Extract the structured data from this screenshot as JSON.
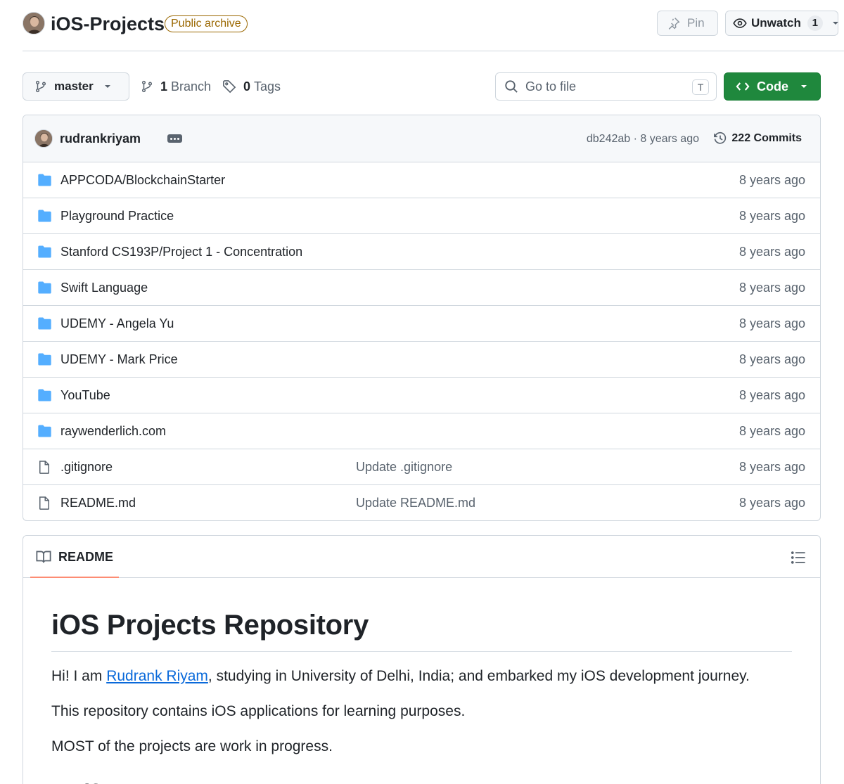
{
  "repo": {
    "name": "iOS-Projects",
    "badge": "Public archive",
    "pin_label": "Pin",
    "watch_label": "Unwatch",
    "watch_count": "1"
  },
  "toolbar": {
    "branch": "master",
    "branch_count": "1",
    "branch_label": "Branch",
    "tag_count": "0",
    "tag_label": "Tags",
    "search_placeholder": "Go to file",
    "search_shortcut": "T",
    "code_label": "Code"
  },
  "commit": {
    "author": "rudrankriyam",
    "sha_age": "db242ab · 8 years ago",
    "commits_label": "222 Commits"
  },
  "files": [
    {
      "type": "dir",
      "name": "APPCODA/BlockchainStarter",
      "message": "",
      "age": "8 years ago"
    },
    {
      "type": "dir",
      "name": "Playground Practice",
      "message": "",
      "age": "8 years ago"
    },
    {
      "type": "dir",
      "name": "Stanford CS193P/Project 1 - Concentration",
      "message": "",
      "age": "8 years ago"
    },
    {
      "type": "dir",
      "name": "Swift Language",
      "message": "",
      "age": "8 years ago"
    },
    {
      "type": "dir",
      "name": "UDEMY - Angela Yu",
      "message": "",
      "age": "8 years ago"
    },
    {
      "type": "dir",
      "name": "UDEMY - Mark Price",
      "message": "",
      "age": "8 years ago"
    },
    {
      "type": "dir",
      "name": "YouTube",
      "message": "",
      "age": "8 years ago"
    },
    {
      "type": "dir",
      "name": "raywenderlich.com",
      "message": "",
      "age": "8 years ago"
    },
    {
      "type": "file",
      "name": ".gitignore",
      "message": "Update .gitignore",
      "age": "8 years ago"
    },
    {
      "type": "file",
      "name": "README.md",
      "message": "Update README.md",
      "age": "8 years ago"
    }
  ],
  "readme": {
    "tab_label": "README",
    "title": "iOS Projects Repository",
    "intro_before": "Hi! I am ",
    "intro_link": "Rudrank Riyam",
    "intro_after": ", studying in University of Delhi, India; and embarked my iOS development journey.",
    "p2": "This repository contains iOS applications for learning purposes.",
    "p3": "MOST of the projects are work in progress.",
    "h2": "Swift Language"
  },
  "colors": {
    "folder": "#54aeff",
    "code_button": "#1f883d",
    "badge": "#9a6700",
    "link": "#0969da",
    "tab_underline": "#fd8c73"
  },
  "icons": {
    "pin": "pin-icon",
    "watch": "eye-icon",
    "branch": "git-branch-icon",
    "tag": "tag-icon",
    "search": "search-icon",
    "code": "code-icon",
    "history": "history-icon",
    "folder": "folder-icon",
    "file": "file-icon",
    "book": "book-icon",
    "toc": "list-unordered-icon"
  }
}
